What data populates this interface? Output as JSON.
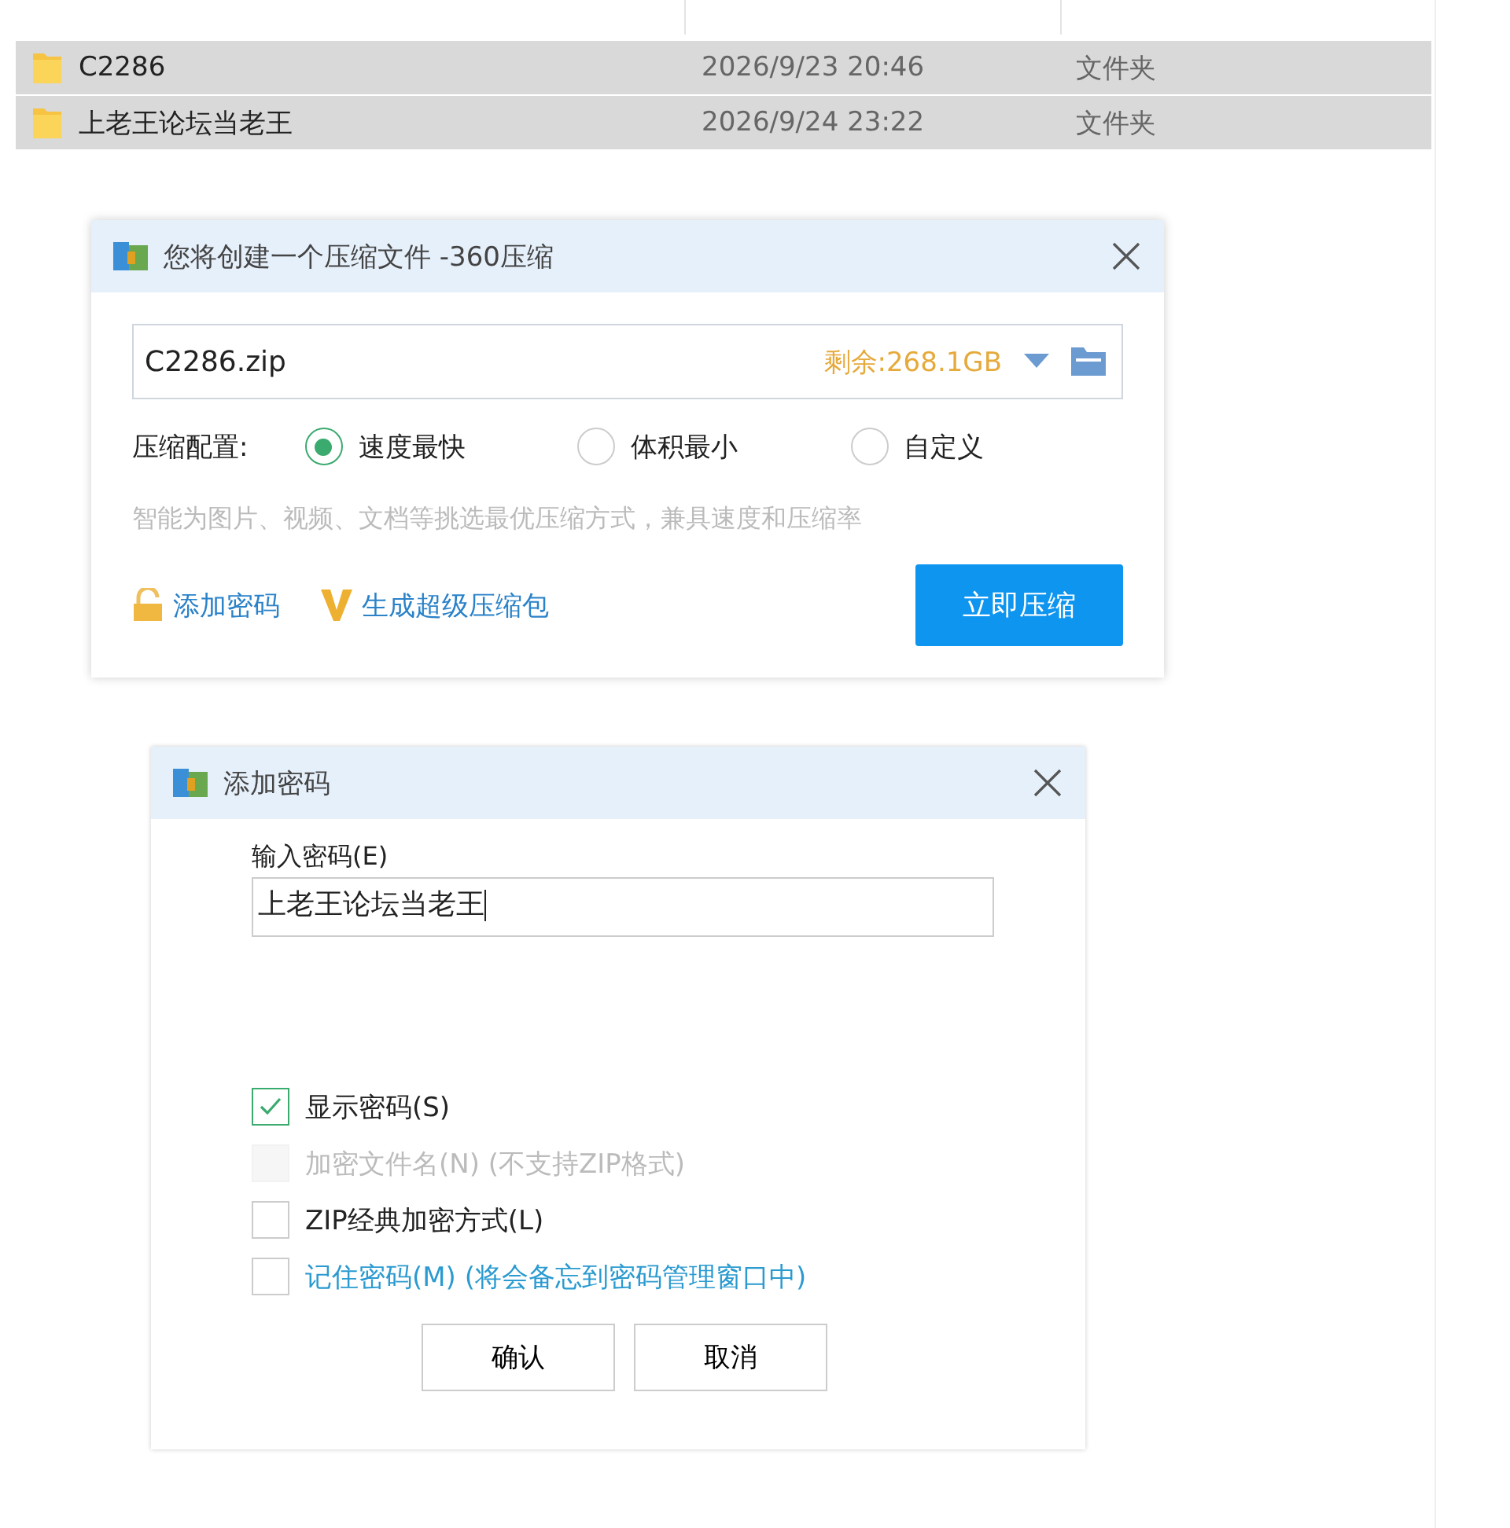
{
  "file_list": {
    "rows": [
      {
        "name": "C2286",
        "modified": "2026/9/23 20:46",
        "type": "文件夹",
        "selected": true
      },
      {
        "name": "上老王论坛当老王",
        "modified": "2026/9/24 23:22",
        "type": "文件夹",
        "selected": true
      }
    ]
  },
  "compress_dialog": {
    "title": "您将创建一个压缩文件 -360压缩",
    "filename": "C2286.zip",
    "free_space": "剩余:268.1GB",
    "config_label": "压缩配置:",
    "modes": [
      {
        "label": "速度最快",
        "selected": true
      },
      {
        "label": "体积最小",
        "selected": false
      },
      {
        "label": "自定义",
        "selected": false
      }
    ],
    "hint": "智能为图片、视频、文档等挑选最优压缩方式，兼具速度和压缩率",
    "add_password": "添加密码",
    "super_package": "生成超级压缩包",
    "compress_button": "立即压缩"
  },
  "password_dialog": {
    "title": "添加密码",
    "input_label": "输入密码(E)",
    "password": "上老王论坛当老王",
    "options": [
      {
        "label": "显示密码(S)",
        "checked": true,
        "disabled": false,
        "kind": "plain"
      },
      {
        "label": "加密文件名(N) (不支持ZIP格式)",
        "checked": false,
        "disabled": true,
        "kind": "plain"
      },
      {
        "label": "ZIP经典加密方式(L)",
        "checked": false,
        "disabled": false,
        "kind": "plain"
      },
      {
        "label": "记住密码(M) (将会备忘到密码管理窗口中)",
        "checked": false,
        "disabled": false,
        "kind": "link"
      }
    ],
    "buttons": [
      "确认",
      "取消"
    ]
  }
}
